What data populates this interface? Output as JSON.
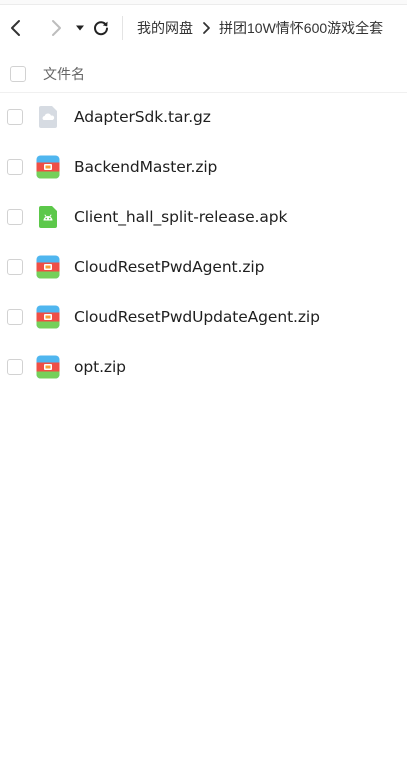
{
  "breadcrumb": {
    "root": "我的网盘",
    "current": "拼团10W情怀600游戏全套"
  },
  "list_header": {
    "name_column": "文件名"
  },
  "files": [
    {
      "name": "AdapterSdk.tar.gz",
      "icon": "archive-gz-icon"
    },
    {
      "name": "BackendMaster.zip",
      "icon": "zip-icon"
    },
    {
      "name": "Client_hall_split-release.apk",
      "icon": "apk-icon"
    },
    {
      "name": "CloudResetPwdAgent.zip",
      "icon": "zip-icon"
    },
    {
      "name": "CloudResetPwdUpdateAgent.zip",
      "icon": "zip-icon"
    },
    {
      "name": "opt.zip",
      "icon": "zip-icon"
    }
  ],
  "colors": {
    "apk_green": "#5cc84a",
    "zip_blue": "#4fb6ef",
    "zip_green": "#75d05a",
    "zip_orange": "#f5a03a",
    "zip_red": "#ef4f45",
    "gz_gray": "#d6dbe2"
  }
}
